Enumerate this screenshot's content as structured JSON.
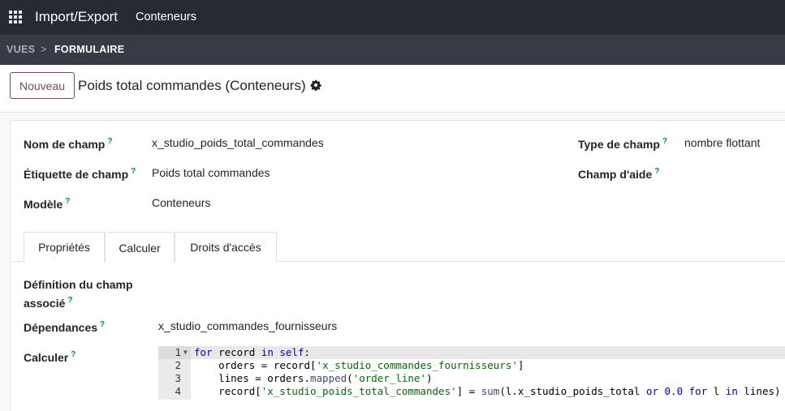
{
  "navbar": {
    "apps_icon": "apps-grid-icon",
    "app_title": "Import/Export",
    "menu_item": "Conteneurs"
  },
  "breadcrumb": {
    "parent": "VUES",
    "separator": ">",
    "current": "FORMULAIRE"
  },
  "control_panel": {
    "new_button": "Nouveau",
    "title": "Poids total commandes (Conteneurs)",
    "gear_icon": "gear-icon"
  },
  "form": {
    "field_name": {
      "label": "Nom de champ",
      "help": "?",
      "value": "x_studio_poids_total_commandes"
    },
    "field_label": {
      "label": "Étiquette de champ",
      "help": "?",
      "value": "Poids total commandes"
    },
    "model": {
      "label": "Modèle",
      "help": "?",
      "value": "Conteneurs"
    },
    "field_type": {
      "label": "Type de champ",
      "help": "?",
      "value": "nombre flottant"
    },
    "help_field": {
      "label": "Champ d'aide",
      "help": "?",
      "value": ""
    }
  },
  "tabs": [
    {
      "label": "Propriétés",
      "active": false
    },
    {
      "label": "Calculer",
      "active": true
    },
    {
      "label": "Droits d'accès",
      "active": false
    }
  ],
  "compute": {
    "related_label_line1": "Définition du champ",
    "related_label_line2": "associé",
    "related_help": "?",
    "depends_label": "Dépendances",
    "depends_help": "?",
    "depends_value": "x_studio_commandes_fournisseurs",
    "compute_label": "Calculer",
    "compute_help": "?"
  },
  "code": {
    "line_numbers": [
      "1",
      "2",
      "3",
      "4"
    ],
    "fold_icon": "fold-arrow-icon",
    "lines": [
      "for record in self:",
      "    orders = record['x_studio_commandes_fournisseurs']",
      "    lines = orders.mapped('order_line')",
      "    record['x_studio_poids_total_commandes'] = sum(l.x_studio_poids_total or 0.0 for l in lines)"
    ]
  },
  "colors": {
    "navbar": "#262a33",
    "breadcrumb_bar": "#363b45",
    "accent": "#714b67",
    "help_marker": "#017e84"
  }
}
